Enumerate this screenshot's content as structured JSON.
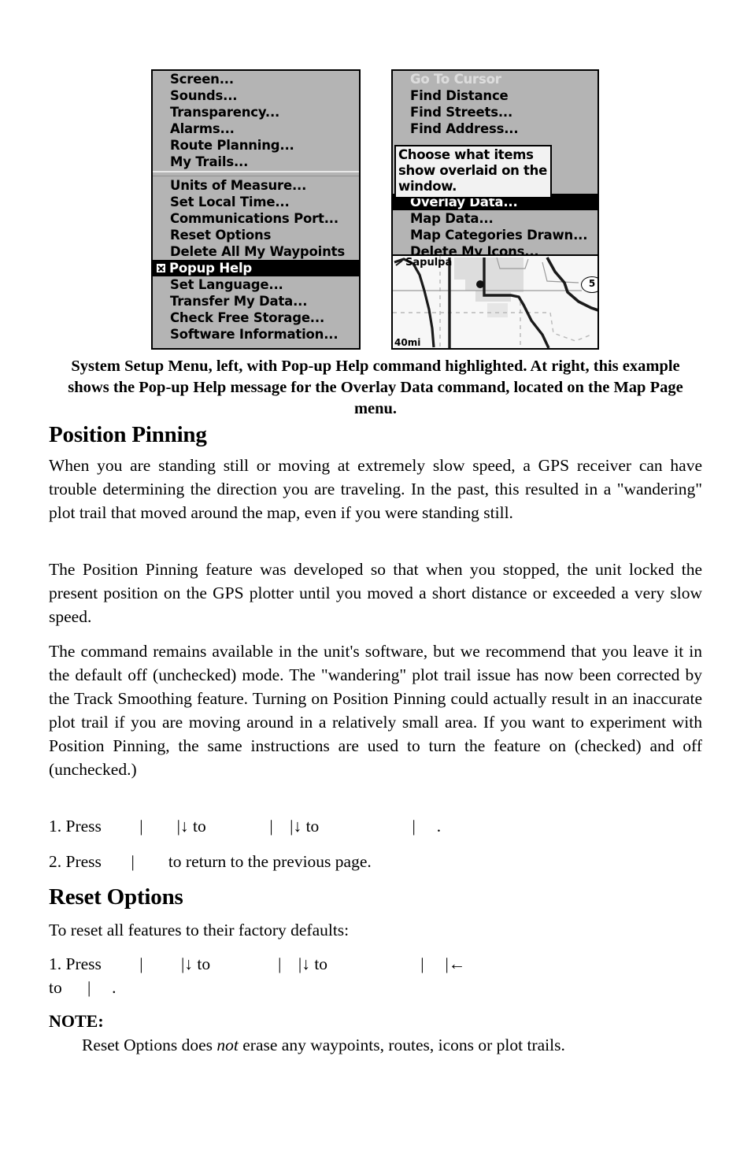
{
  "figure": {
    "left_screen": {
      "name": "System Setup Menu",
      "group1": [
        "Screen...",
        "Sounds...",
        "Transparency...",
        "Alarms...",
        "Route Planning...",
        "My Trails..."
      ],
      "group2": [
        "Units of Measure...",
        "Set Local Time...",
        "Communications Port...",
        "Reset Options",
        "Delete All My Waypoints"
      ],
      "selected_item": {
        "label": "Popup Help",
        "checked": true
      },
      "group3": [
        "Set Language...",
        "Transfer My Data...",
        "Check Free Storage...",
        "Software Information..."
      ]
    },
    "right_screen": {
      "name": "Map Page Menu",
      "top_items": [
        {
          "label": "Go To Cursor",
          "dimmed": true
        },
        {
          "label": "Find Distance",
          "dimmed": false
        },
        {
          "label": "Find Streets...",
          "dimmed": false
        },
        {
          "label": "Find Address...",
          "dimmed": false
        }
      ],
      "help_popup_lines": [
        "Choose what items",
        "show overlaid on the",
        "window."
      ],
      "selected_item": {
        "label": "Overlay Data..."
      },
      "bottom_items": [
        "Map Data...",
        "Map Categories Drawn...",
        "Delete My Icons..."
      ],
      "map": {
        "town_label": "Sapulpa",
        "scale_label": "40mi",
        "highway_shield": "5"
      }
    },
    "caption": "System Setup Menu, left, with Pop-up Help command highlighted. At right, this example shows the Pop-up Help message for the Overlay Data command, located on the Map Page menu."
  },
  "sections": {
    "position_pinning": {
      "heading": "Position Pinning",
      "paragraphs": [
        "When you are standing still or moving at extremely slow speed, a GPS receiver can have trouble determining the direction you are traveling. In the past, this resulted in a \"wandering\" plot trail that moved around the map, even if you were standing still.",
        "The Position Pinning feature was developed so that when you stopped, the unit locked the present position on the GPS plotter until you moved a short distance or exceeded a very slow speed.",
        "The command remains available in the unit's software, but we recommend that you leave it in the default off (unchecked) mode. The \"wandering\" plot trail issue has now been corrected by the Track Smoothing feature. Turning on Position Pinning could actually result in an inaccurate plot trail if you are moving around in a relatively small area. If you want to experiment with Position Pinning, the same instructions are used to turn the feature on (checked) and off (unchecked.)"
      ],
      "steps": [
        "1. Press         |        |↓ to               |    |↓ to                      |     .",
        "2. Press       |        to return to the previous page."
      ]
    },
    "reset_options": {
      "heading": "Reset Options",
      "intro": "To reset all features to their factory defaults:",
      "steps": [
        "1. Press         |         |↓ to                |    |↓ to                      |     |←",
        "to      |     ."
      ]
    },
    "note": {
      "label": "NOTE:",
      "text_before": "Reset Options does ",
      "text_italic": "not",
      "text_after": " erase any waypoints, routes, icons or plot trails."
    }
  }
}
